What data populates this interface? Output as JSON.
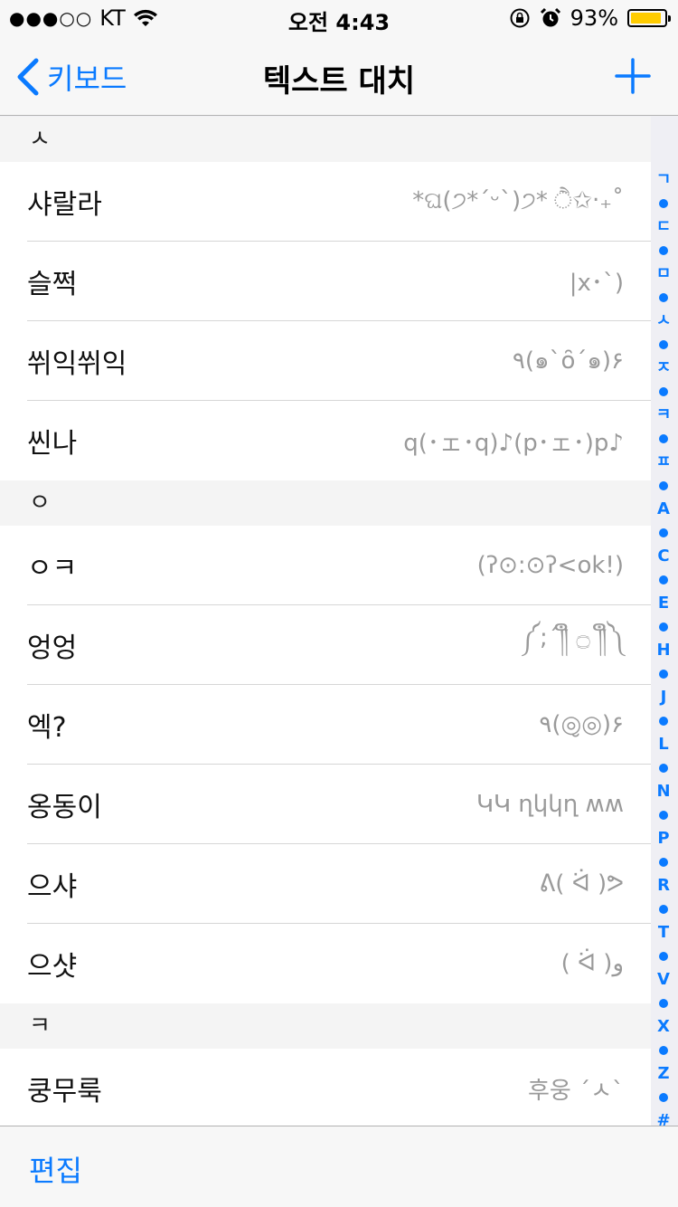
{
  "status": {
    "signal": "●●●○○",
    "carrier": "KT",
    "time": "오전 4:43",
    "battery_percent": "93%",
    "battery_level": 0.93,
    "battery_color": "#ffcc00"
  },
  "nav": {
    "back_label": "키보드",
    "title": "텍스트 대치",
    "accent": "#0a7aff"
  },
  "sections": [
    {
      "header": "ㅅ",
      "rows": [
        {
          "phrase": "샤랄라",
          "value": "*ଘ(੭*ˊᵕˋ)੭* ੈ✩‧₊˚"
        },
        {
          "phrase": "슬쩍",
          "value": "|x･ˋ)"
        },
        {
          "phrase": "쒸익쒸익",
          "value": "٩(๑`ȏ´๑)۶"
        },
        {
          "phrase": "씬나",
          "value": "q(･ェ･q)♪(p･ェ･)p♪"
        }
      ]
    },
    {
      "header": "ㅇ",
      "rows": [
        {
          "phrase": "ㅇㅋ",
          "value": "(ʔ⊙:⊙ʔ<ok!)"
        },
        {
          "phrase": "엉엉",
          "value": "༼;´༎ຶ ۝ ༎ຶ༽"
        },
        {
          "phrase": "엑?",
          "value": "٩(◎̮◎)۶"
        },
        {
          "phrase": "옹동이",
          "value": "ԿԿ ղկկղ ʍʍ"
        },
        {
          "phrase": "으샤",
          "value": "ᕕ( ᐛ )ᕗ"
        },
        {
          "phrase": "으샷",
          "value": "( ᐛ )و"
        }
      ]
    },
    {
      "header": "ㅋ",
      "rows": [
        {
          "phrase": "쿵무룩",
          "value": "후웅 ˊㅅˋ"
        }
      ]
    }
  ],
  "index": [
    "ㄱ",
    "ㄷ",
    "ㅁ",
    "ㅅ",
    "ㅈ",
    "ㅋ",
    "ㅍ",
    "A",
    "C",
    "E",
    "H",
    "J",
    "L",
    "N",
    "P",
    "R",
    "T",
    "V",
    "X",
    "Z",
    "#"
  ],
  "toolbar": {
    "edit_label": "편집"
  },
  "icons": {
    "wifi": "wifi-icon",
    "rotation_lock": "rotation-lock-icon",
    "alarm": "alarm-icon",
    "back": "chevron-left-icon",
    "add": "plus-icon"
  }
}
